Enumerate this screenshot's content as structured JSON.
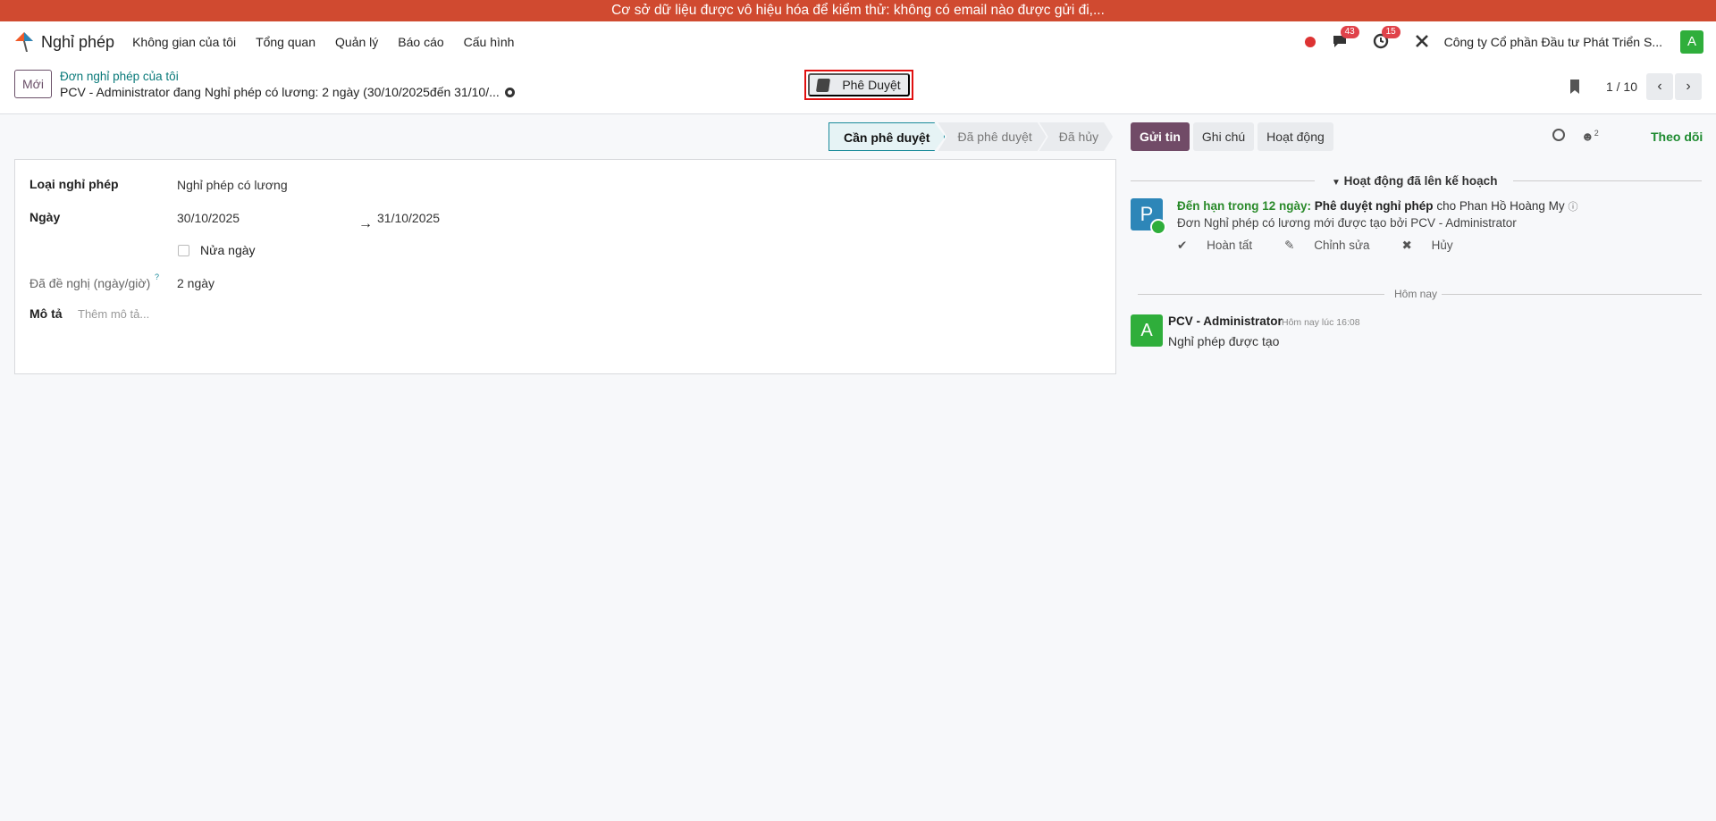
{
  "banner": {
    "text": "Cơ sở dữ liệu được vô hiệu hóa để kiểm thử: không có email nào được gửi đi,..."
  },
  "navbar": {
    "app_name": "Nghỉ phép",
    "menu": [
      "Không gian của tôi",
      "Tổng quan",
      "Quản lý",
      "Báo cáo",
      "Cấu hình"
    ],
    "messages_badge": "43",
    "activities_badge": "15",
    "company": "Công ty Cổ phần Đầu tư Phát Triển S...",
    "user_initial": "A"
  },
  "control": {
    "new_label": "Mới",
    "breadcrumb_parent": "Đơn nghỉ phép của tôi",
    "record_title": "PCV - Administrator đang Nghỉ phép có lương: 2 ngày (30/10/2025đến 31/10/...",
    "approve_label": "Phê Duyệt",
    "pager": "1 / 10"
  },
  "status": {
    "stages": [
      "Cần phê duyệt",
      "Đã phê duyệt",
      "Đã hủy"
    ],
    "active_index": 0
  },
  "form": {
    "leave_type_label": "Loại nghỉ phép",
    "leave_type_value": "Nghỉ phép có lương",
    "dates_label": "Ngày",
    "date_from": "30/10/2025",
    "date_to": "31/10/2025",
    "half_day_label": "Nửa ngày",
    "requested_label": "Đã đề nghị (ngày/giờ)",
    "requested_hint": "?",
    "requested_value": "2 ngày",
    "description_label": "Mô tả",
    "description_placeholder": "Thêm mô tả..."
  },
  "chatter": {
    "send_label": "Gửi tin",
    "note_label": "Ghi chú",
    "activity_label": "Hoạt động",
    "followers_count": "2",
    "follow_label": "Theo dõi",
    "planned_header": "Hoạt động đã lên kế hoạch",
    "activity": {
      "avatar": "P",
      "due": "Đến hạn trong 12 ngày:",
      "type": "Phê duyệt nghỉ phép",
      "assignee": "cho Phan Hồ Hoàng My",
      "summary": "Đơn Nghỉ phép có lương mới được tạo bởi PCV - Administrator",
      "done": "Hoàn tất",
      "edit": "Chỉnh sửa",
      "cancel": "Hủy"
    },
    "today_label": "Hôm nay",
    "message": {
      "avatar": "A",
      "author": "PCV - Administrator",
      "time": "Hôm nay lúc 16:08",
      "body": "Nghỉ phép được tạo"
    }
  },
  "colors": {
    "banner": "#d04a30",
    "primary": "#714b67",
    "link": "#0a7a7a",
    "success": "#2fae3b"
  }
}
